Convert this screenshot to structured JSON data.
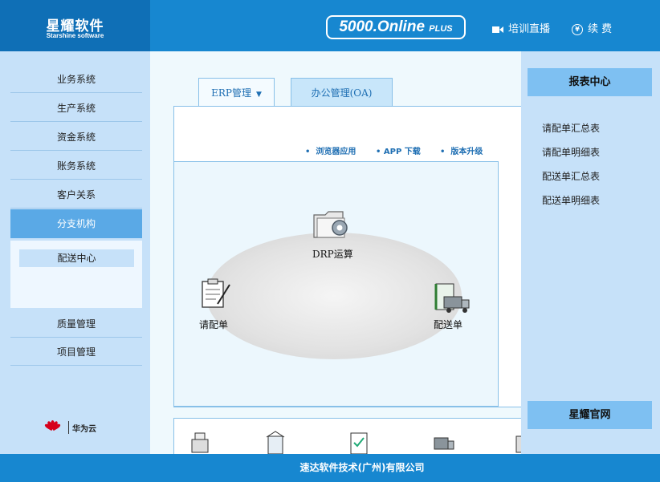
{
  "header": {
    "logo_main": "星耀软件",
    "logo_sub": "Starshine software",
    "badge_main": "5000.Online",
    "badge_plus": "PLUS",
    "training_label": "培训直播",
    "renew_label": "续 费",
    "icons": [
      "camera-icon",
      "renew-icon"
    ]
  },
  "sidebar": {
    "items": [
      {
        "label": "业务系统"
      },
      {
        "label": "生产系统"
      },
      {
        "label": "资金系统"
      },
      {
        "label": "账务系统"
      },
      {
        "label": "客户关系"
      },
      {
        "label": "分支机构",
        "active": true
      }
    ],
    "sub_items": [
      {
        "label": "配送中心"
      }
    ],
    "items_after": [
      {
        "label": "质量管理"
      },
      {
        "label": "项目管理"
      }
    ],
    "partner_text": "华为云"
  },
  "tabs": [
    {
      "label": "ERP管理",
      "active": true
    },
    {
      "label": "办公管理(OA)",
      "active": false
    }
  ],
  "quick_links": [
    {
      "label": "浏览器应用"
    },
    {
      "label": "APP 下载"
    },
    {
      "label": "版本升级"
    }
  ],
  "diagram": {
    "nodes": [
      {
        "label": "DRP运算",
        "icon": "folder-gear-icon"
      },
      {
        "label": "请配单",
        "icon": "clipboard-icon"
      },
      {
        "label": "配送单",
        "icon": "truck-document-icon"
      }
    ]
  },
  "report_center": {
    "title": "报表中心",
    "links": [
      {
        "label": "请配单汇总表"
      },
      {
        "label": "请配单明细表"
      },
      {
        "label": "配送单汇总表"
      },
      {
        "label": "配送单明细表"
      }
    ],
    "official_site": "星耀官网"
  },
  "footer": {
    "text": "速达软件技术(广州)有限公司"
  },
  "colors": {
    "brand_blue": "#1787d0",
    "logo_blue": "#0f6fb6",
    "sidebar_bg": "#c6e1f9",
    "active_nav": "#5aa9e6",
    "panel_button": "#7ec0f2"
  }
}
